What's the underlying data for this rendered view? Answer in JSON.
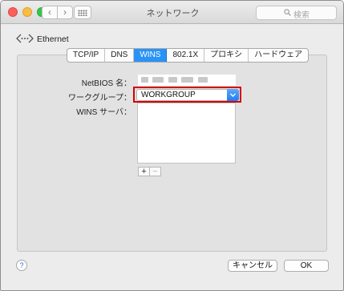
{
  "window": {
    "title": "ネットワーク"
  },
  "search": {
    "placeholder": "検索"
  },
  "toolbar": {
    "back_glyph": "‹",
    "forward_glyph": "›"
  },
  "service": {
    "name": "Ethernet",
    "icon": "ethernet-icon"
  },
  "tabs": [
    {
      "label": "TCP/IP",
      "active": false
    },
    {
      "label": "DNS",
      "active": false
    },
    {
      "label": "WINS",
      "active": true
    },
    {
      "label": "802.1X",
      "active": false
    },
    {
      "label": "プロキシ",
      "active": false
    },
    {
      "label": "ハードウェア",
      "active": false
    }
  ],
  "form": {
    "netbios_label": "NetBIOS 名：",
    "workgroup_label": "ワークグループ：",
    "workgroup_value": "WORKGROUP",
    "wins_servers_label": "WINS サーバ："
  },
  "list_controls": {
    "add_glyph": "+",
    "remove_glyph": "−"
  },
  "help": {
    "glyph": "?"
  },
  "buttons": {
    "cancel_label": "キャンセル",
    "ok_label": "OK"
  },
  "colors": {
    "accent": "#2a93f6",
    "highlight_border": "#d60000"
  }
}
